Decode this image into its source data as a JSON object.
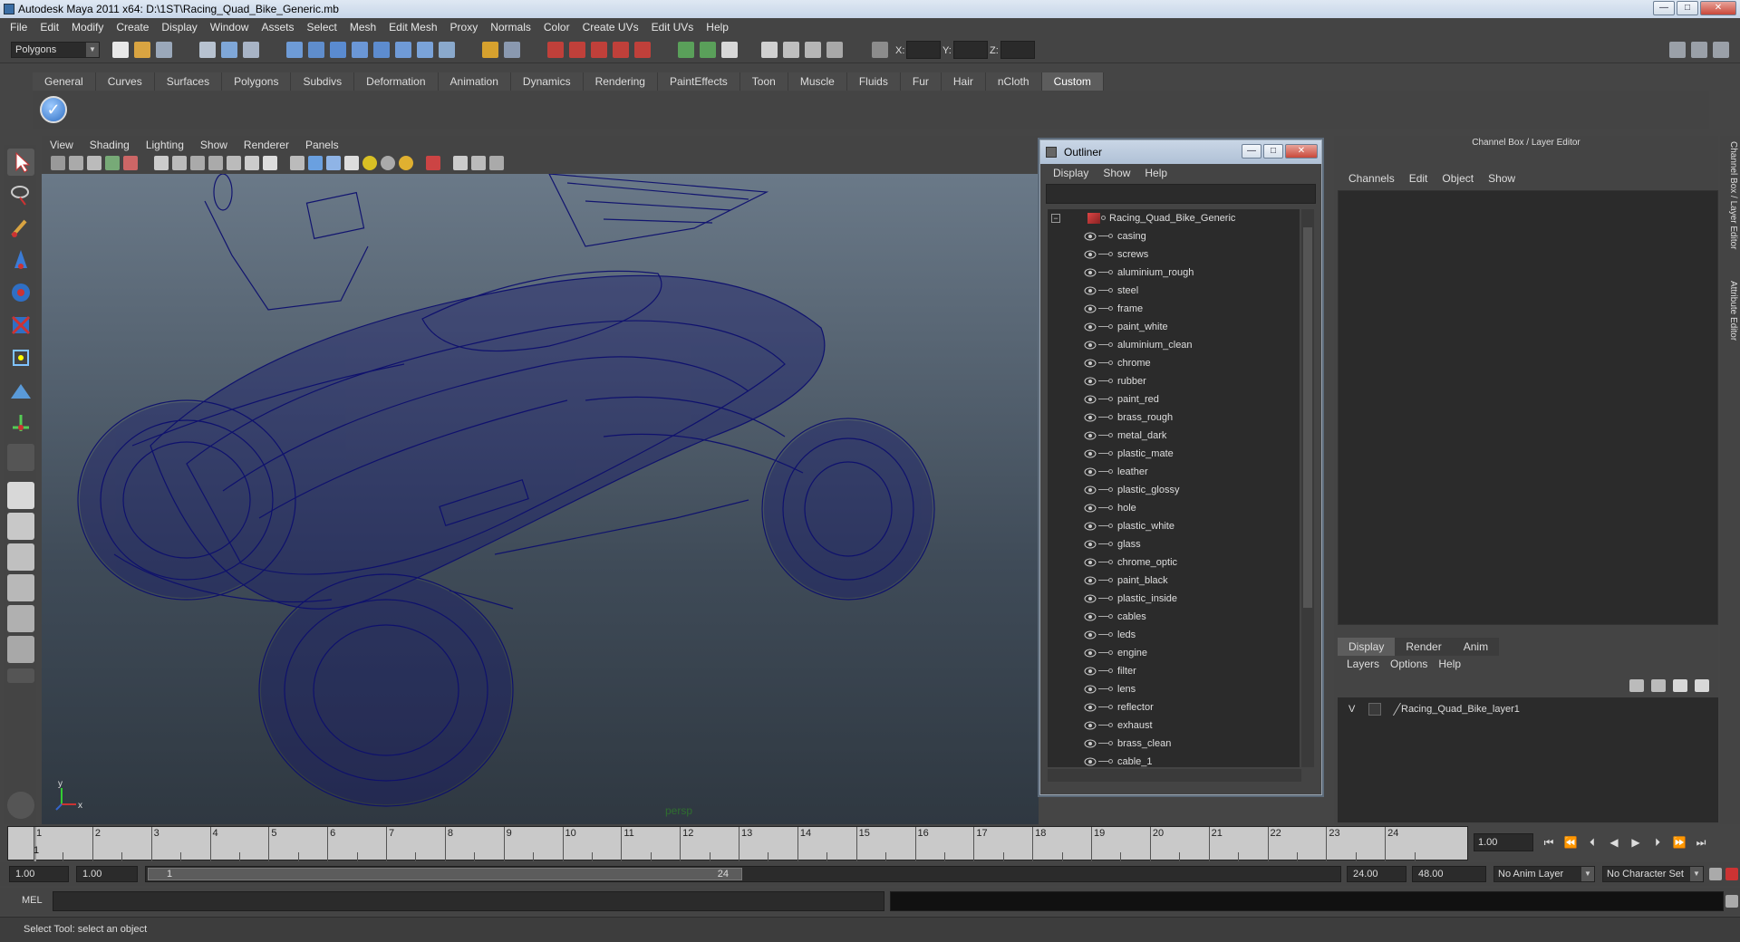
{
  "window": {
    "title": "Autodesk Maya 2011 x64: D:\\1ST\\Racing_Quad_Bike_Generic.mb",
    "minimize": "—",
    "maximize": "□",
    "close": "✕"
  },
  "menubar": [
    "File",
    "Edit",
    "Modify",
    "Create",
    "Display",
    "Window",
    "Assets",
    "Select",
    "Mesh",
    "Edit Mesh",
    "Proxy",
    "Normals",
    "Color",
    "Create UVs",
    "Edit UVs",
    "Help"
  ],
  "statusline": {
    "mode": "Polygons",
    "x_label": "X:",
    "y_label": "Y:",
    "z_label": "Z:"
  },
  "shelf": {
    "tabs": [
      "General",
      "Curves",
      "Surfaces",
      "Polygons",
      "Subdivs",
      "Deformation",
      "Animation",
      "Dynamics",
      "Rendering",
      "PaintEffects",
      "Toon",
      "Muscle",
      "Fluids",
      "Fur",
      "Hair",
      "nCloth",
      "Custom"
    ],
    "active": "Custom",
    "check": "✓"
  },
  "viewport": {
    "menu": [
      "View",
      "Shading",
      "Lighting",
      "Show",
      "Renderer",
      "Panels"
    ],
    "camera": "persp",
    "axis_x": "x",
    "axis_y": "y"
  },
  "outliner": {
    "title": "Outliner",
    "menu": [
      "Display",
      "Show",
      "Help"
    ],
    "collapse": "−",
    "root": "Racing_Quad_Bike_Generic",
    "items": [
      "casing",
      "screws",
      "aluminium_rough",
      "steel",
      "frame",
      "paint_white",
      "aluminium_clean",
      "chrome",
      "rubber",
      "paint_red",
      "brass_rough",
      "metal_dark",
      "plastic_mate",
      "leather",
      "plastic_glossy",
      "hole",
      "plastic_white",
      "glass",
      "chrome_optic",
      "paint_black",
      "plastic_inside",
      "cables",
      "leds",
      "engine",
      "filter",
      "lens",
      "reflector",
      "exhaust",
      "brass_clean",
      "cable_1"
    ]
  },
  "channelbox": {
    "title": "Channel Box / Layer Editor",
    "menu": [
      "Channels",
      "Edit",
      "Object",
      "Show"
    ],
    "tabs": [
      "Display",
      "Render",
      "Anim"
    ],
    "active_tab": "Display",
    "layer_menu": [
      "Layers",
      "Options",
      "Help"
    ],
    "layer": {
      "visibility": "V",
      "name": "Racing_Quad_Bike_layer1"
    },
    "side_tabs": [
      "Channel Box / Layer Editor",
      "Attribute Editor"
    ]
  },
  "timeline": {
    "ticks": [
      "1",
      "2",
      "3",
      "4",
      "5",
      "6",
      "7",
      "8",
      "9",
      "10",
      "11",
      "12",
      "13",
      "14",
      "15",
      "16",
      "17",
      "18",
      "19",
      "20",
      "21",
      "22",
      "23",
      "24"
    ],
    "current": "1",
    "current_field": "1.00",
    "playback": [
      "⏮",
      "⏪",
      "⏴",
      "◀",
      "▶",
      "⏵",
      "⏩",
      "⏭"
    ]
  },
  "range": {
    "start": "1.00",
    "playback_start": "1.00",
    "thumb_start": "1",
    "thumb_end": "24",
    "playback_end": "24.00",
    "end": "48.00",
    "anim_layer": "No Anim Layer",
    "char_set": "No Character Set"
  },
  "cmdline": {
    "label": "MEL"
  },
  "helpline": {
    "text": "Select Tool: select an object"
  },
  "colors": {
    "wire": "#0d0f6e",
    "viewport_top": "#6a7988",
    "viewport_bottom": "#2f3841"
  }
}
